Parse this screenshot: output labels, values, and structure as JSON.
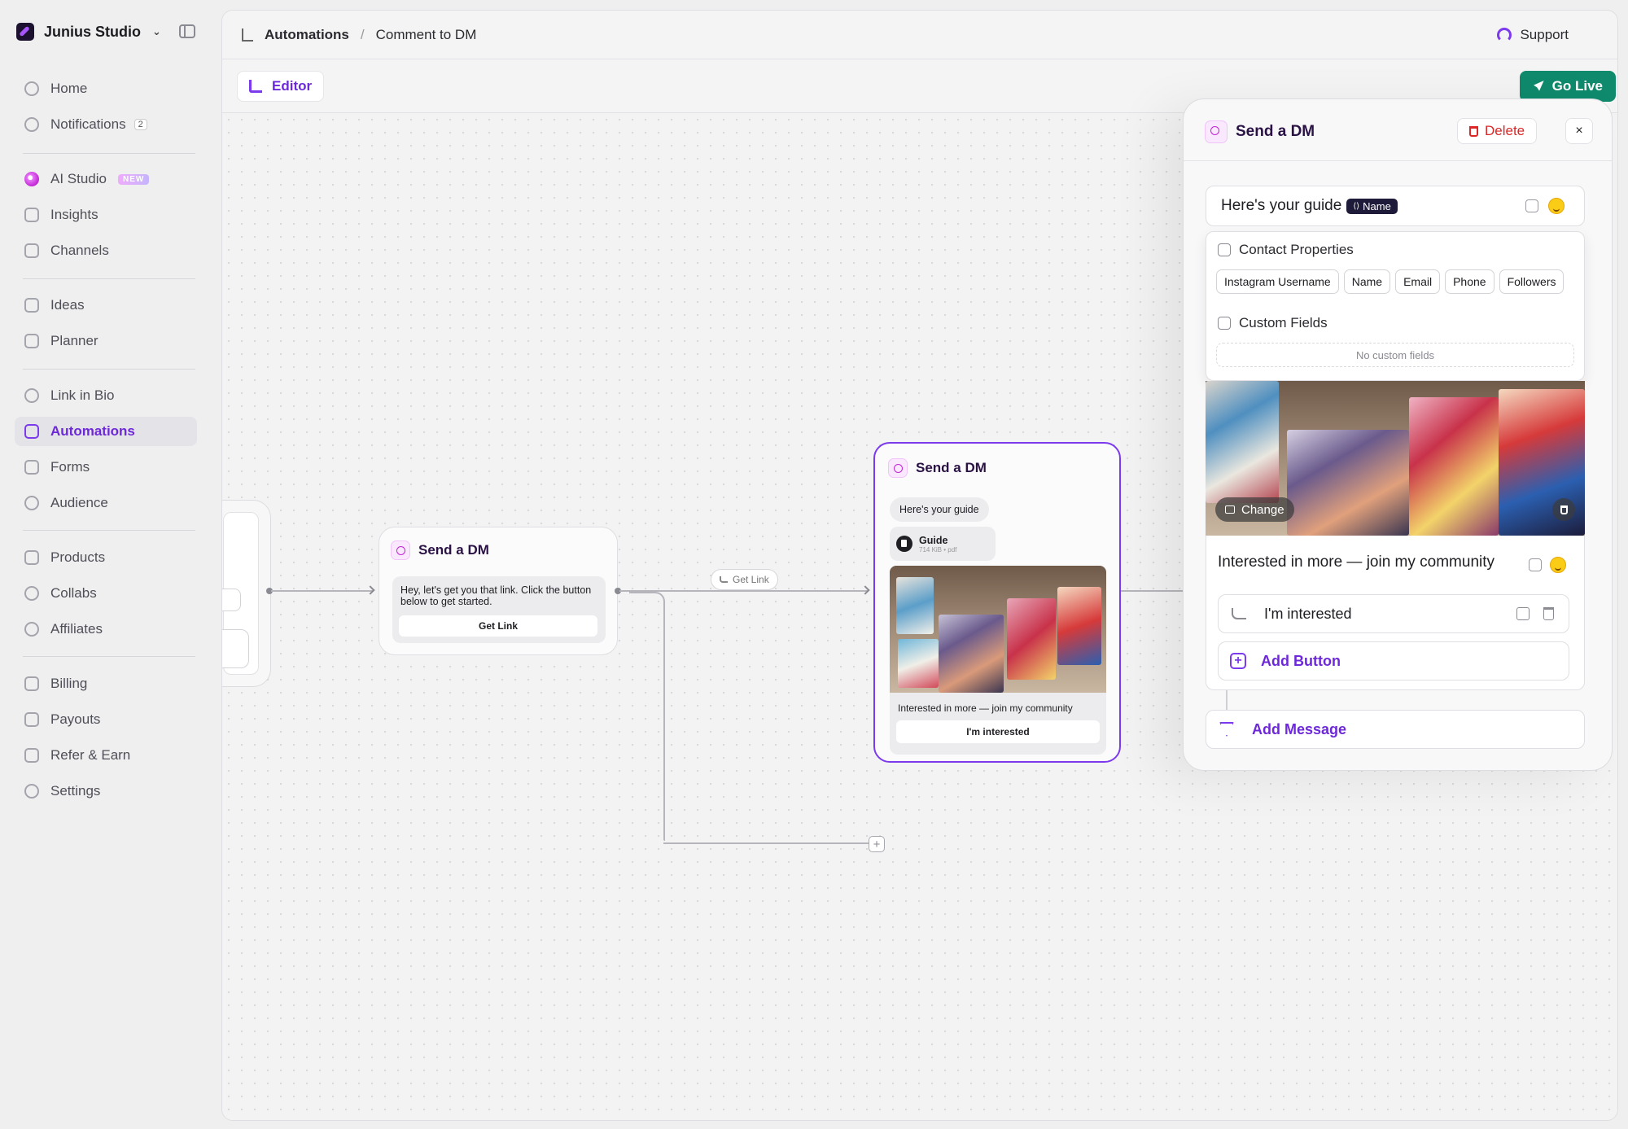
{
  "workspace": {
    "name": "Junius Studio"
  },
  "nav": {
    "home": "Home",
    "notifications": "Notifications",
    "notifications_count": "2",
    "ai_studio": "AI Studio",
    "ai_badge": "NEW",
    "insights": "Insights",
    "channels": "Channels",
    "ideas": "Ideas",
    "planner": "Planner",
    "link_in_bio": "Link in Bio",
    "automations": "Automations",
    "forms": "Forms",
    "audience": "Audience",
    "products": "Products",
    "collabs": "Collabs",
    "affiliates": "Affiliates",
    "billing": "Billing",
    "payouts": "Payouts",
    "refer": "Refer & Earn",
    "settings": "Settings"
  },
  "breadcrumb": {
    "root": "Automations",
    "separator": "/",
    "current": "Comment to DM"
  },
  "header": {
    "support": "Support",
    "editor_tab": "Editor",
    "go_live": "Go Live"
  },
  "node1": {
    "title": "Send a DM",
    "text": "Hey, let's get you that link. Click the button below to get started.",
    "button": "Get Link"
  },
  "edge": {
    "label": "Get Link"
  },
  "node2": {
    "title": "Send a DM",
    "message": "Here's your guide",
    "file_name": "Guide",
    "file_meta": "714 KiB • pdf",
    "caption": "Interested in more — join my community",
    "button": "I'm interested"
  },
  "panel": {
    "title": "Send a DM",
    "delete": "Delete",
    "close": "×",
    "message_text": "Here's your guide",
    "name_chip": "Name",
    "contact_properties": "Contact Properties",
    "properties": [
      "Instagram Username",
      "Name",
      "Email",
      "Phone",
      "Followers"
    ],
    "custom_fields": "Custom Fields",
    "no_custom_fields": "No custom fields",
    "change": "Change",
    "caption": "Interested in more — join my community",
    "button_label": "I'm interested",
    "add_button": "Add Button",
    "add_message": "Add Message"
  },
  "colors": {
    "accent": "#7c3aed",
    "go_live": "#0f8a6c",
    "delete": "#dc2626",
    "name_chip": "#1e1b3a"
  }
}
